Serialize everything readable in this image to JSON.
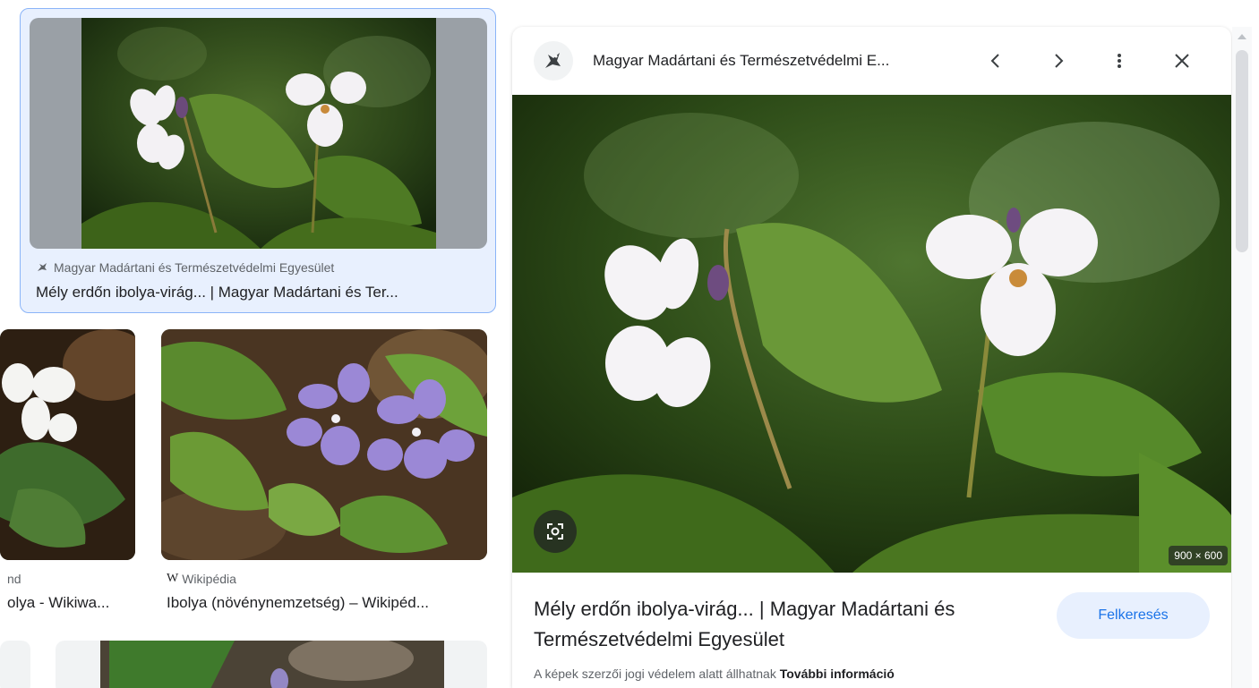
{
  "results": {
    "selected": {
      "source": "Magyar Madártani és Természetvédelmi Egyesület",
      "title": "Mély erdőn ibolya-virág... | Magyar Madártani és Ter..."
    },
    "items": [
      {
        "source": "nd",
        "title": "olya - Wikiwa..."
      },
      {
        "source": "Wikipédia",
        "source_icon": "W",
        "title": "Ibolya (növénynemzetség) – Wikipéd..."
      }
    ]
  },
  "preview": {
    "site_name": "Magyar Madártani és Természetvédelmi E...",
    "dimensions": "900 × 600",
    "title": "Mély erdőn ibolya-virág... | Magyar Madártani és Természetvédelmi Egyesület",
    "visit_label": "Felkeresés",
    "copyright_text": "A képek szerzői jogi védelem alatt állhatnak",
    "more_info_label": "További információ"
  },
  "colors": {
    "accent": "#1a73e8",
    "selected_bg": "#e8f0fe",
    "selected_border": "#8ab4f8"
  },
  "icons": [
    "bird-logo-icon",
    "chevron-left-icon",
    "chevron-right-icon",
    "more-vert-icon",
    "close-icon",
    "lens-icon",
    "wikipedia-icon"
  ]
}
